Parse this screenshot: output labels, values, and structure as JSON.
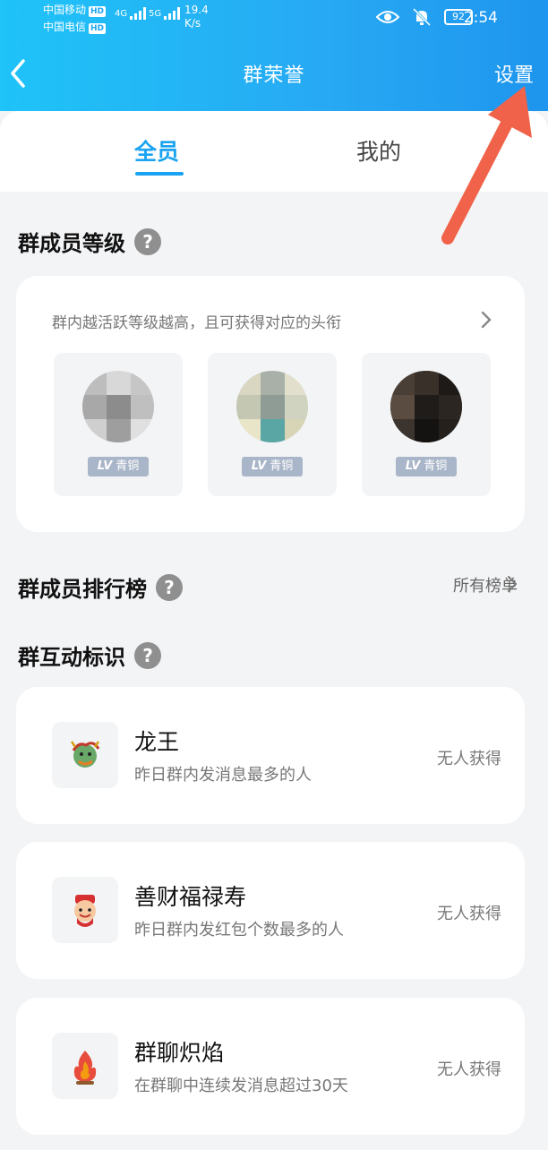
{
  "status": {
    "carrier1": "中国移动",
    "carrier2": "中国电信",
    "hd": "HD",
    "sig1": "4G",
    "sig2": "5G",
    "speed_value": "19.4",
    "speed_unit": "K/s",
    "battery": "92",
    "time": "2:54"
  },
  "nav": {
    "title": "群荣誉",
    "settings": "设置"
  },
  "tabs": [
    {
      "label": "全员"
    },
    {
      "label": "我的"
    }
  ],
  "sections": {
    "level": {
      "title": "群成员等级",
      "hint": "群内越活跃等级越高，且可获得对应的头衔"
    },
    "ranking": {
      "title": "群成员排行榜",
      "all_lists": "所有榜单"
    },
    "interaction": {
      "title": "群互动标识"
    }
  },
  "members": [
    {
      "badge_lv": "LV",
      "badge_text": "青铜"
    },
    {
      "badge_lv": "LV",
      "badge_text": "青铜"
    },
    {
      "badge_lv": "LV",
      "badge_text": "青铜"
    }
  ],
  "identities": [
    {
      "name": "龙王",
      "desc": "昨日群内发消息最多的人",
      "status": "无人获得",
      "icon": "dragon-icon"
    },
    {
      "name": "善财福禄寿",
      "desc": "昨日群内发红包个数最多的人",
      "status": "无人获得",
      "icon": "fortune-god-icon"
    },
    {
      "name": "群聊炽焰",
      "desc": "在群聊中连续发消息超过30天",
      "status": "无人获得",
      "icon": "flame-icon"
    }
  ],
  "colors": {
    "accent": "#1aa3f0",
    "header_start": "#1fc3f8",
    "header_end": "#1e95ee",
    "annotation_arrow": "#f0634a",
    "badge": "#a9b5c8"
  }
}
